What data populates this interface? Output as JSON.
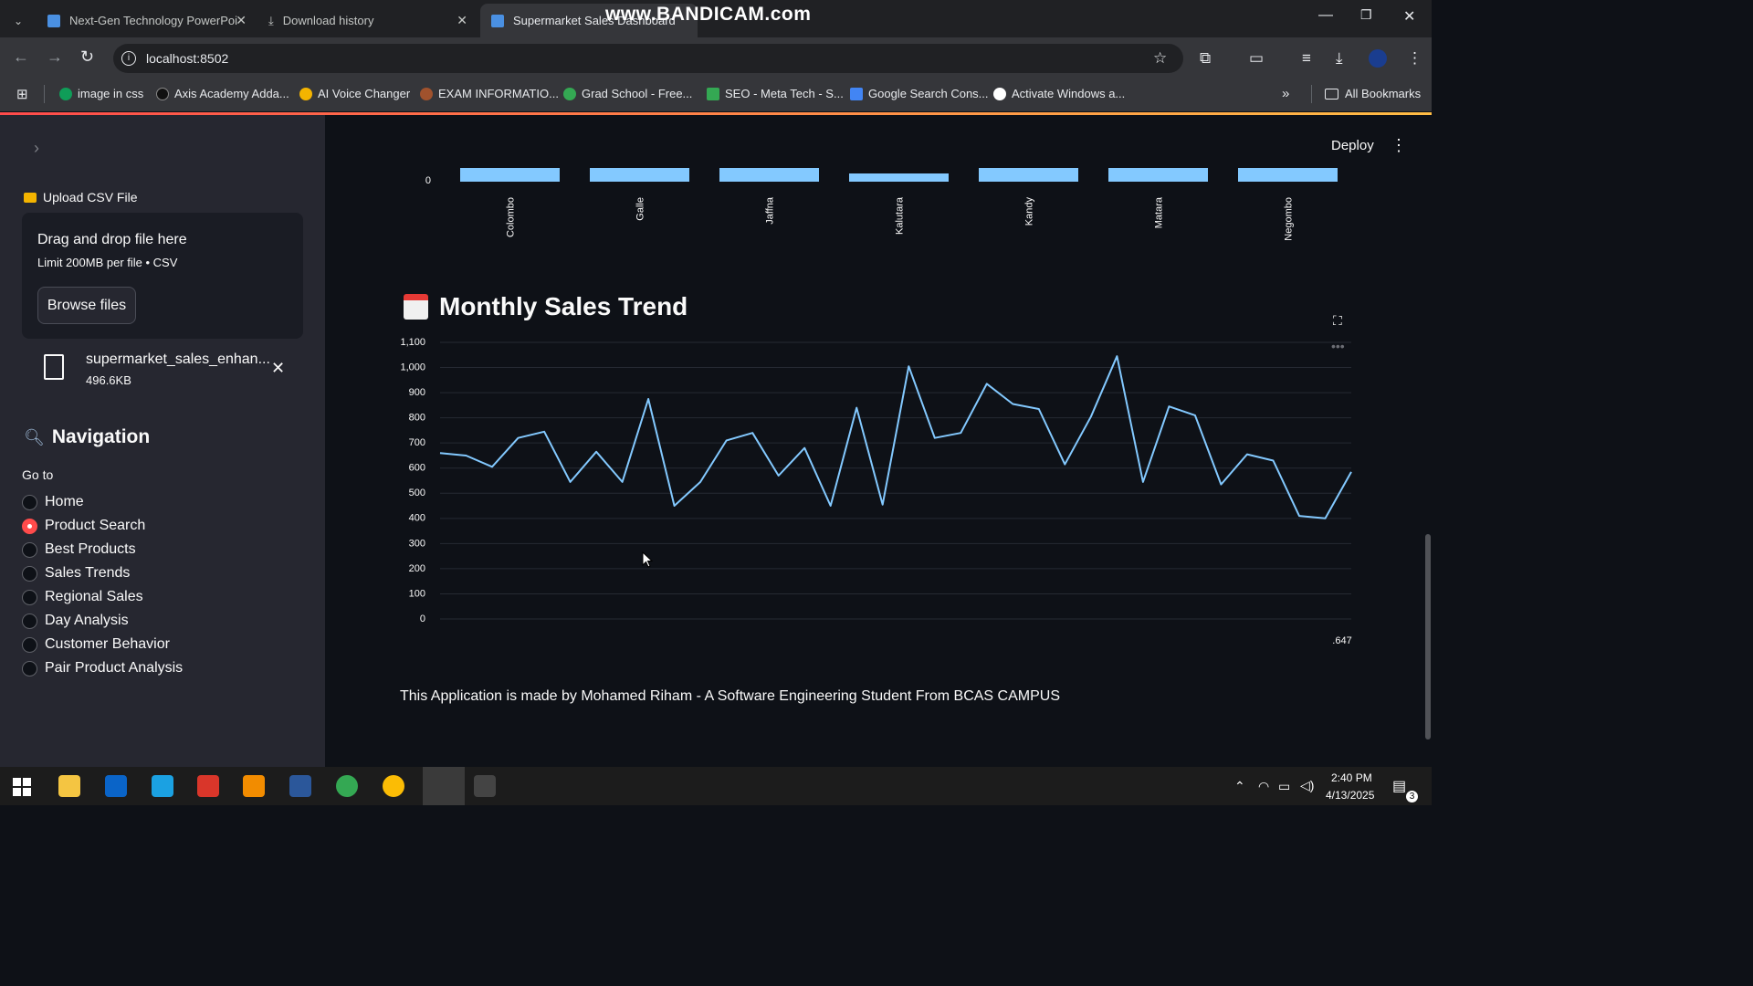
{
  "browser": {
    "tabs": [
      {
        "title": "Next-Gen Technology PowerPoi",
        "color": "#4a90e2"
      },
      {
        "title": "Download history",
        "color": "#c4c7c5"
      },
      {
        "title": "Supermarket Sales Dashboard",
        "color": "#4a90e2"
      }
    ],
    "watermark": "www.BANDICAM.com",
    "url": "localhost:8502",
    "bookmarks": [
      {
        "label": "image in css",
        "color": "#0f9d58"
      },
      {
        "label": "Axis Academy Adda...",
        "color": "#333333"
      },
      {
        "label": "AI Voice Changer",
        "color": "#f4b400"
      },
      {
        "label": "EXAM INFORMATIO...",
        "color": "#a0522d"
      },
      {
        "label": "Grad School - Free...",
        "color": "#34a853"
      },
      {
        "label": "SEO - Meta Tech - S...",
        "color": "#34a853"
      },
      {
        "label": "Google Search Cons...",
        "color": "#4285f4"
      },
      {
        "label": "Activate Windows a...",
        "color": "#ffffff"
      }
    ],
    "all_bookmarks": "All Bookmarks"
  },
  "sidebar": {
    "upload_title": "Upload CSV File",
    "drop_text": "Drag and drop file here",
    "limit_text": "Limit 200MB per file • CSV",
    "browse_label": "Browse files",
    "file_name": "supermarket_sales_enhan...",
    "file_size": "496.6KB",
    "nav_title": "Navigation",
    "goto_label": "Go to",
    "nav_items": [
      {
        "label": "Home",
        "selected": false
      },
      {
        "label": "Product Search",
        "selected": true
      },
      {
        "label": "Best Products",
        "selected": false
      },
      {
        "label": "Sales Trends",
        "selected": false
      },
      {
        "label": "Regional Sales",
        "selected": false
      },
      {
        "label": "Day Analysis",
        "selected": false
      },
      {
        "label": "Customer Behavior",
        "selected": false
      },
      {
        "label": "Pair Product Analysis",
        "selected": false
      }
    ]
  },
  "header": {
    "deploy_label": "Deploy"
  },
  "section_title": "Monthly Sales Trend",
  "footer_text": "This Application is made by Mohamed Riham - A Software Engineering Student From BCAS CAMPUS",
  "chart_data": [
    {
      "type": "bar",
      "categories": [
        "Colombo",
        "Galle",
        "Jaffna",
        "Kalutara",
        "Kandy",
        "Matara",
        "Negombo"
      ],
      "values": [
        1,
        1,
        1,
        0.6,
        1,
        1,
        1
      ],
      "y_tick_labels": [
        "0"
      ],
      "color": "#83c9ff",
      "note_visible": "cropped top, only baseline visible"
    },
    {
      "type": "line",
      "color": "#83c9ff",
      "ylim": [
        0,
        1100
      ],
      "y_ticks": [
        0,
        100,
        200,
        300,
        400,
        500,
        600,
        700,
        800,
        900,
        1000,
        1100
      ],
      "y_tick_labels": [
        "0",
        "100",
        "200",
        "300",
        "400",
        "500",
        "600",
        "700",
        "800",
        "900",
        "1,000",
        "1,100"
      ],
      "x_tick_label": ".647",
      "values": [
        660,
        650,
        605,
        720,
        745,
        545,
        665,
        545,
        875,
        450,
        545,
        710,
        740,
        570,
        680,
        450,
        840,
        455,
        1005,
        720,
        740,
        935,
        855,
        835,
        615,
        805,
        1045,
        545,
        845,
        810,
        535,
        655,
        630,
        410,
        400,
        585
      ]
    }
  ],
  "taskbar": {
    "time": "2:40 PM",
    "date": "4/13/2025",
    "notifications": "3",
    "apps": [
      {
        "name": "file-explorer",
        "color": "#f4c542"
      },
      {
        "name": "outlook",
        "color": "#0a64c8"
      },
      {
        "name": "edge",
        "color": "#1ba1e2"
      },
      {
        "name": "app-red",
        "color": "#d9362a"
      },
      {
        "name": "vlc",
        "color": "#f28c00"
      },
      {
        "name": "word",
        "color": "#2b579a"
      },
      {
        "name": "chrome-1",
        "color": "#34a853"
      },
      {
        "name": "chrome-2",
        "color": "#fbbc05"
      },
      {
        "name": "chrome-3",
        "color": "#ea4335"
      },
      {
        "name": "terminal",
        "color": "#444444"
      }
    ]
  }
}
